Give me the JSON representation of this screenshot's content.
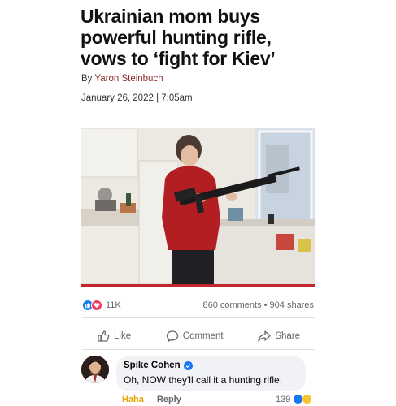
{
  "article": {
    "headline_lines": [
      "Ukrainian mom buys",
      "powerful hunting rifle,",
      "vows to ‘fight for Kiev’"
    ],
    "byline_prefix": "By ",
    "author": "Yaron Steinbuch",
    "date": "January 26, 2022 | 7:05am"
  },
  "post": {
    "reaction_count": "11K",
    "stats": "860 comments • 904 shares",
    "actions": {
      "like": "Like",
      "comment": "Comment",
      "share": "Share"
    }
  },
  "comment": {
    "author": "Spike Cohen",
    "text": "Oh, NOW they'll call it a hunting rifle.",
    "reaction_label": "Haha",
    "reply_label": "Reply",
    "reaction_count": "139"
  },
  "icons": [
    "like-reaction-icon",
    "love-reaction-icon",
    "thumbs-up-icon",
    "comment-icon",
    "share-icon",
    "verified-badge-icon"
  ],
  "colors": {
    "brand": "#1877f2",
    "love": "#f33e58",
    "haha": "#e8a400",
    "accent_bar": "#c1262c",
    "author_link": "#8a2b25"
  }
}
